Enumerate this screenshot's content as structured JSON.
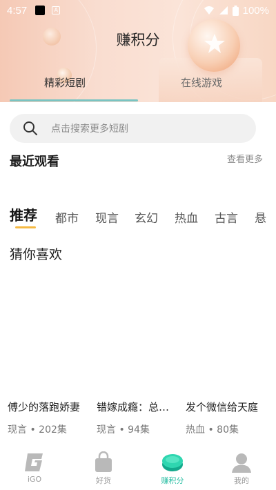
{
  "status_bar": {
    "time": "4:57",
    "battery": "100%"
  },
  "header": {
    "title": "赚积分",
    "tabs": [
      {
        "label": "精彩短剧",
        "active": true
      },
      {
        "label": "在线游戏",
        "active": false
      }
    ],
    "accent_color": "#79c4c2"
  },
  "search": {
    "placeholder": "点击搜索更多短剧"
  },
  "recent": {
    "title": "最近观看",
    "more_label": "查看更多"
  },
  "categories": {
    "items": [
      "推荐",
      "都市",
      "现言",
      "玄幻",
      "热血",
      "古言",
      "悬"
    ],
    "active_index": 0,
    "underline_color": "#f5b942"
  },
  "guess": {
    "title": "猜你喜欢",
    "cards": [
      {
        "title": "傅少的落跑娇妻",
        "meta": "现言 • 202集"
      },
      {
        "title": "错嫁成瘾：总…",
        "meta": "现言 • 94集"
      },
      {
        "title": "发个微信给天庭",
        "meta": "热血 • 80集"
      }
    ]
  },
  "bottom_nav": {
    "items": [
      {
        "label": "iGO",
        "icon": "igo-logo-icon",
        "active": false
      },
      {
        "label": "好货",
        "icon": "shopping-bag-icon",
        "active": false
      },
      {
        "label": "赚积分",
        "icon": "earn-points-icon",
        "active": true
      },
      {
        "label": "我的",
        "icon": "profile-icon",
        "active": false
      }
    ],
    "active_color": "#2bbfa4"
  }
}
